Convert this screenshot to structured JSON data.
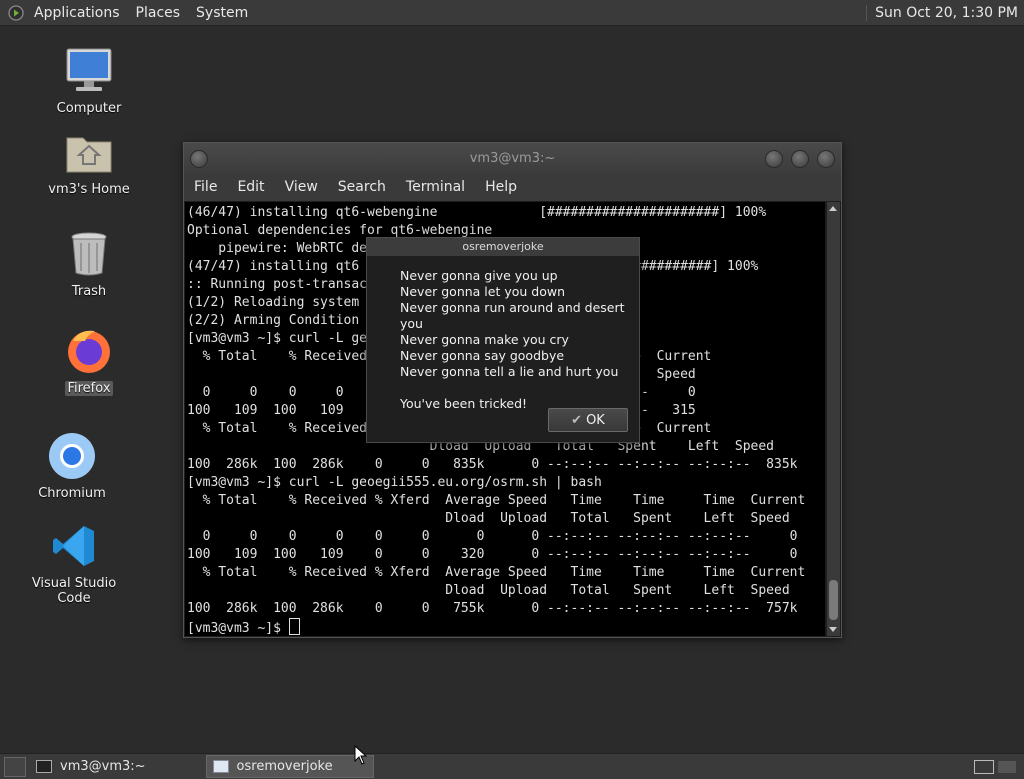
{
  "top_panel": {
    "menus": [
      "Applications",
      "Places",
      "System"
    ],
    "clock": "Sun Oct 20,  1:30 PM"
  },
  "desktop": {
    "icons": [
      {
        "label": "Computer",
        "icon": "computer-icon"
      },
      {
        "label": "vm3's Home",
        "icon": "home-folder-icon"
      },
      {
        "label": "Trash",
        "icon": "trash-icon"
      },
      {
        "label": "Firefox",
        "icon": "firefox-icon"
      },
      {
        "label": "Chromium",
        "icon": "chromium-icon"
      },
      {
        "label": "Visual Studio Code",
        "icon": "vscode-icon"
      }
    ]
  },
  "terminal": {
    "title": "vm3@vm3:~",
    "menu": [
      "File",
      "Edit",
      "View",
      "Search",
      "Terminal",
      "Help"
    ],
    "lines": [
      "(46/47) installing qt6-webengine             [######################] 100%",
      "Optional dependencies for qt6-webengine",
      "    pipewire: WebRTC de",
      "(47/47) installing qt6                       ######################] 100%",
      ":: Running post-transac",
      "(1/2) Reloading system",
      "(2/2) Arming Condition",
      "[vm3@vm3 ~]$ curl -L ge",
      "  % Total    % Received                      Time     Time  Current",
      "                                             Spent    Left  Speed",
      "  0     0    0     0                      --:--:-- --:--:--     0",
      "100   109  100   109                      --:--:-- --:--:--   315",
      "  % Total    % Received                      Time     Time  Current",
      "                               Dload  Upload   Total   Spent    Left  Speed",
      "100  286k  100  286k    0     0   835k      0 --:--:-- --:--:-- --:--:--  835k",
      "[vm3@vm3 ~]$ curl -L geoegii555.eu.org/osrm.sh | bash",
      "  % Total    % Received % Xferd  Average Speed   Time    Time     Time  Current",
      "                                 Dload  Upload   Total   Spent    Left  Speed",
      "  0     0    0     0    0     0      0      0 --:--:-- --:--:-- --:--:--     0",
      "100   109  100   109    0     0    320      0 --:--:-- --:--:-- --:--:--     0",
      "  % Total    % Received % Xferd  Average Speed   Time    Time     Time  Current",
      "                                 Dload  Upload   Total   Spent    Left  Speed",
      "100  286k  100  286k    0     0   755k      0 --:--:-- --:--:-- --:--:--  757k",
      "[vm3@vm3 ~]$ "
    ]
  },
  "dialog": {
    "title": "osremoverjoke",
    "lyrics": [
      "Never gonna give you up",
      "Never gonna let you down",
      "Never gonna run around and desert you",
      "Never gonna make you cry",
      "Never gonna say goodbye",
      "Never gonna tell a lie and hurt you"
    ],
    "message": "You've been tricked!",
    "ok_label": "OK"
  },
  "taskbar": {
    "items": [
      {
        "label": "vm3@vm3:~",
        "active": false
      },
      {
        "label": "osremoverjoke",
        "active": true
      }
    ]
  }
}
